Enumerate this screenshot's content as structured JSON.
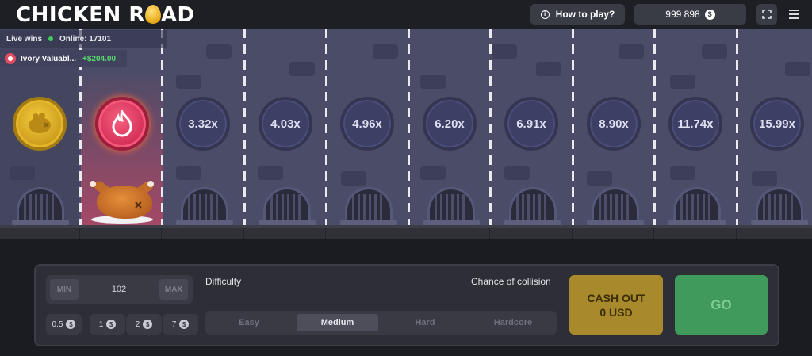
{
  "header": {
    "logo_left": "CHICKEN R",
    "logo_right": "AD",
    "how_to_play": "How to play?",
    "info_icon": "i",
    "balance": "999 898",
    "currency_symbol": "$"
  },
  "live": {
    "title": "Live wins",
    "online": "Online: 17101",
    "win_name": "Ivory Valuabl...",
    "win_amount": "+$204.00"
  },
  "lanes": {
    "multipliers": [
      "3.32x",
      "4.03x",
      "4.96x",
      "6.20x",
      "6.91x",
      "8.90x",
      "11.74x",
      "15.99x"
    ]
  },
  "controls": {
    "min_label": "MIN",
    "max_label": "MAX",
    "bet_value": "102",
    "chips": [
      "0.5",
      "1",
      "2",
      "7"
    ],
    "chip_currency": "$",
    "difficulty_label": "Difficulty",
    "collision_label": "Chance of collision",
    "difficulties": [
      "Easy",
      "Medium",
      "Hard",
      "Hardcore"
    ],
    "selected_difficulty": "Medium",
    "cashout_line1": "CASH OUT",
    "cashout_line2": "0 USD",
    "go_label": "GO"
  },
  "colors": {
    "background": "#1b1c21",
    "game_bg": "#4a4c68",
    "cashout": "#a8892b",
    "go": "#3f9a5c",
    "win_green": "#59d86e"
  },
  "icons": [
    "info-icon",
    "dollar-coin-icon",
    "fullscreen-icon",
    "menu-icon",
    "flame-icon",
    "roast-chicken-icon",
    "egg-icon"
  ]
}
